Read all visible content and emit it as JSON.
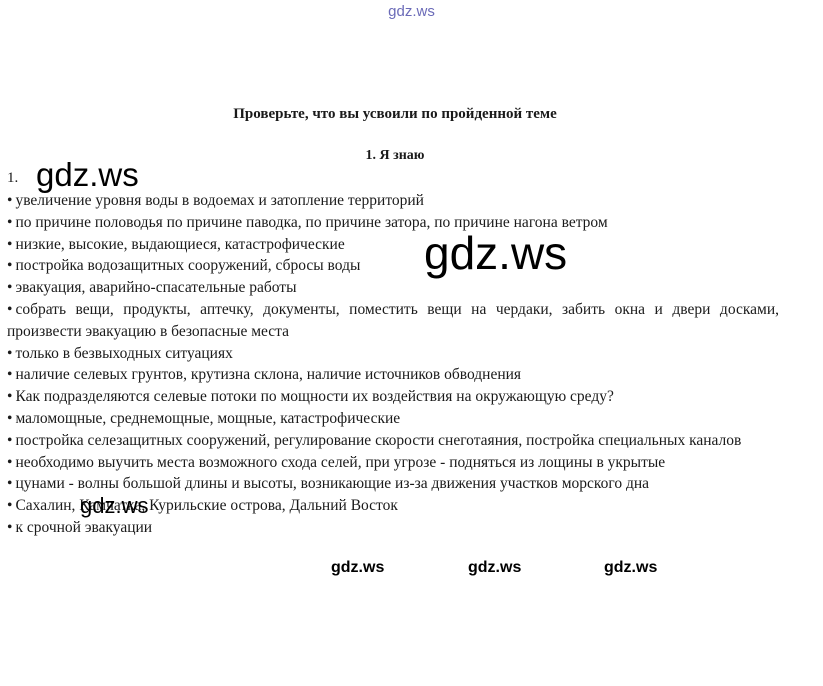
{
  "watermarks": {
    "top": "gdz.ws",
    "big1": "gdz.ws",
    "huge": "gdz.ws",
    "mid": "gdz.ws",
    "small": [
      "gdz.ws",
      "gdz.ws",
      "gdz.ws"
    ]
  },
  "heading": {
    "title": "Проверьте, что вы усвоили по пройденной теме",
    "subtitle": "1. Я знаю"
  },
  "question_number": "1.",
  "items": [
    "увеличение уровня воды в водоемах и затопление территорий",
    "по причине половодья  по причине паводка, по причине затора, по причине нагона ветром",
    "низкие, высокие, выдающиеся, катастрофические",
    "постройка водозащитных сооружений, сбросы воды",
    "эвакуация, аварийно-спасательные работы",
    "собрать вещи, продукты, аптечку, документы, поместить вещи на чердаки, забить окна и двери досками, произвести эвакуацию в безопасные места",
    "только в безвыходных ситуациях",
    "наличие селевых грунтов, крутизна склона, наличие источников обводнения",
    "Как подразделяются селевые потоки по мощности их воздействия на окружающую среду?",
    "маломощные, среднемощные, мощные, катастрофические",
    "постройка селезащитных сооружений, регулирование скорости снеготаяния, постройка специальных каналов",
    "необходимо выучить места возможного схода селей, при угрозе - подняться из лощины в укрытые",
    "цунами - волны большой длины и высоты, возникающие из-за движения участков морского  дна",
    "Сахалин, Камчатка, Курильские острова, Дальний Восток",
    "к срочной эвакуации"
  ]
}
